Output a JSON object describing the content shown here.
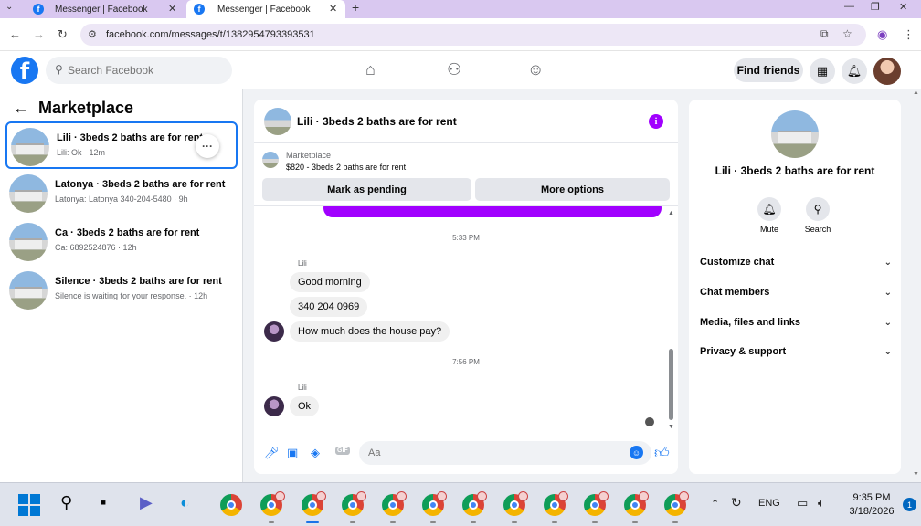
{
  "browser": {
    "tabs": [
      {
        "title": "Messenger | Facebook",
        "active": false
      },
      {
        "title": "Messenger | Facebook",
        "active": true
      }
    ],
    "url": "facebook.com/messages/t/1382954793393531"
  },
  "fb_header": {
    "search_placeholder": "Search Facebook",
    "find_friends": "Find friends"
  },
  "left_panel": {
    "title": "Marketplace",
    "conversations": [
      {
        "name": "Lili · 3beds 2 baths are for rent",
        "sub": "Lili: Ok · 12m",
        "selected": true
      },
      {
        "name": "Latonya · 3beds 2 baths are for rent",
        "sub": "Latonya: Latonya 340-204-5480 · 9h"
      },
      {
        "name": "Ca · 3beds 2 baths are for rent",
        "sub": "Ca: 6892524876 · 12h"
      },
      {
        "name": "Silence · 3beds 2 baths are for rent",
        "sub": "Silence is waiting for your response. · 12h"
      }
    ]
  },
  "chat": {
    "title": "Lili · 3beds 2 baths are for rent",
    "marketplace_label": "Marketplace",
    "listing": "$820 - 3beds 2 baths are for rent",
    "mark_pending": "Mark as pending",
    "more_options": "More options",
    "timestamps": [
      "5:33 PM",
      "7:56 PM"
    ],
    "sender": "Lili",
    "messages_group1": [
      "Good morning",
      "340 204 0969",
      "How much does the house pay?"
    ],
    "messages_group2": [
      "Ok"
    ],
    "composer_placeholder": "Aa"
  },
  "right_panel": {
    "title": "Lili · 3beds 2 baths are for rent",
    "mute": "Mute",
    "search": "Search",
    "sections": [
      "Customize chat",
      "Chat members",
      "Media, files and links",
      "Privacy & support"
    ]
  },
  "taskbar": {
    "language": "ENG",
    "time": "9:35 PM",
    "date": "3/18/2026",
    "notifications": "1"
  },
  "colors": {
    "fb_blue": "#1877f2",
    "messenger_purple": "#a100ff"
  }
}
